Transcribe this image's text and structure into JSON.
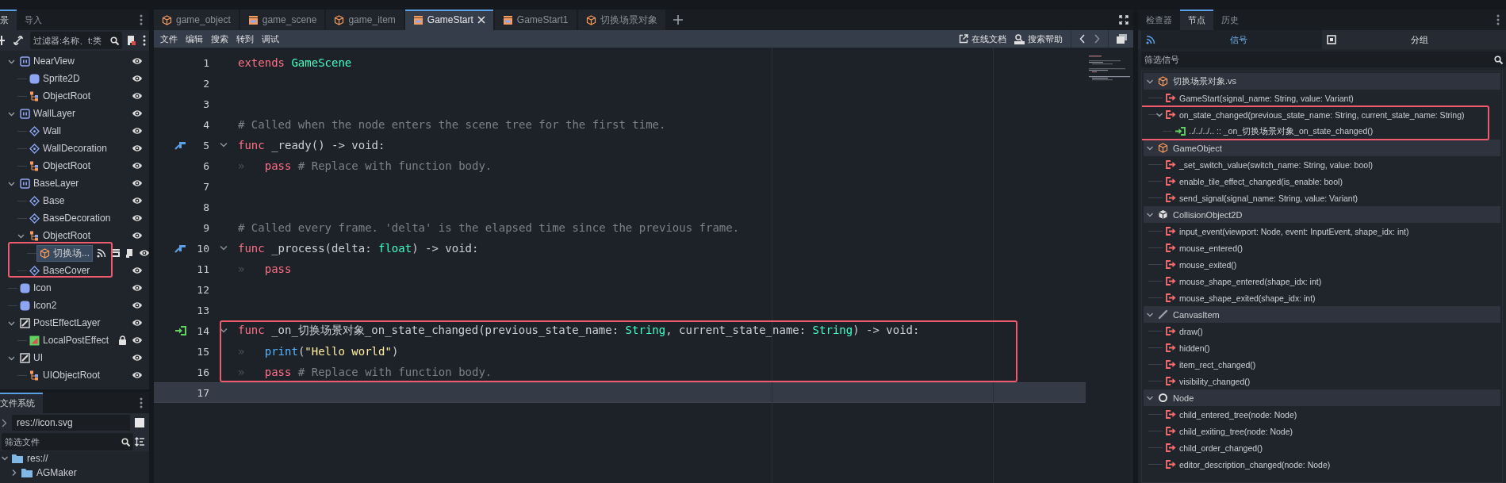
{
  "left_tabs": [
    {
      "label": "景",
      "selected": true
    },
    {
      "label": "导入",
      "selected": false
    }
  ],
  "scene_filter": {
    "placeholder": "过滤器:名称、t:类"
  },
  "scene_tree": [
    {
      "name": "NearView",
      "kind": "layer",
      "expanded": true,
      "children": [
        {
          "name": "Sprite2D",
          "kind": "sprite"
        },
        {
          "name": "ObjectRoot",
          "kind": "root"
        }
      ]
    },
    {
      "name": "WallLayer",
      "kind": "layer",
      "expanded": true,
      "children": [
        {
          "name": "Wall",
          "kind": "marker"
        },
        {
          "name": "WallDecoration",
          "kind": "marker"
        },
        {
          "name": "ObjectRoot",
          "kind": "root"
        }
      ]
    },
    {
      "name": "BaseLayer",
      "kind": "layer",
      "expanded": true,
      "children": [
        {
          "name": "Base",
          "kind": "marker"
        },
        {
          "name": "BaseDecoration",
          "kind": "marker"
        },
        {
          "name": "ObjectRoot",
          "kind": "root",
          "expanded": true,
          "children": [
            {
              "name": "切换场...",
              "kind": "object",
              "selected": true,
              "annotated": true,
              "signals": true,
              "instance": true,
              "script": true
            }
          ]
        },
        {
          "name": "BaseCover",
          "kind": "marker"
        }
      ]
    },
    {
      "name": "Icon",
      "kind": "sprite"
    },
    {
      "name": "Icon2",
      "kind": "sprite"
    },
    {
      "name": "PostEffectLayer",
      "kind": "canvas",
      "expanded": true,
      "children": [
        {
          "name": "LocalPostEffect",
          "kind": "post",
          "locked": true
        }
      ]
    },
    {
      "name": "UI",
      "kind": "canvas",
      "expanded": true,
      "children": [
        {
          "name": "UIObjectRoot",
          "kind": "root"
        }
      ]
    }
  ],
  "filesystem": {
    "tab": "文件系统",
    "path": "res://icon.svg",
    "filter": {
      "placeholder": "筛选文件"
    },
    "items": [
      {
        "name": "res://",
        "expanded": true
      },
      {
        "name": "AGMaker",
        "expanded": false
      }
    ]
  },
  "editor_tabs": [
    {
      "label": "game_object",
      "kind": "object",
      "selected": false
    },
    {
      "label": "game_scene",
      "kind": "scene",
      "selected": false
    },
    {
      "label": "game_item",
      "kind": "object",
      "selected": false
    },
    {
      "label": "GameStart",
      "kind": "scene",
      "selected": true
    },
    {
      "label": "GameStart1",
      "kind": "scene",
      "selected": false
    },
    {
      "label": "切换场景对象",
      "kind": "object",
      "selected": false
    }
  ],
  "editor_menu": [
    "文件",
    "编辑",
    "搜索",
    "转到",
    "调试"
  ],
  "help_buttons": [
    {
      "label": "在线文档",
      "kind": "docs"
    },
    {
      "label": "搜索帮助",
      "kind": "help"
    }
  ],
  "code": {
    "lines": [
      {
        "number": "1",
        "current": false,
        "segments": [
          {
            "text": "extends",
            "kind": "keyword"
          },
          {
            "text": " GameScene",
            "kind": "type"
          }
        ]
      },
      {
        "number": "2",
        "current": false
      },
      {
        "number": "3",
        "current": false
      },
      {
        "number": "4",
        "current": false,
        "segments": [
          {
            "text": "# Called when the node enters the scene tree for the first time.",
            "kind": "comment"
          }
        ]
      },
      {
        "number": "5",
        "current": false,
        "connected": true,
        "foldable": true,
        "segments": [
          {
            "text": "func",
            "kind": "keyword"
          },
          {
            "text": " _ready() -> void:",
            "kind": "plain"
          }
        ]
      },
      {
        "number": "6",
        "current": false,
        "segments": [
          {
            "text": "»",
            "kind": "tab"
          },
          {
            "text": "pass",
            "kind": "keyword"
          },
          {
            "text": " # Replace with function body.",
            "kind": "comment"
          }
        ]
      },
      {
        "number": "7",
        "current": false
      },
      {
        "number": "8",
        "current": false
      },
      {
        "number": "9",
        "current": false,
        "segments": [
          {
            "text": "# Called every frame. 'delta' is the elapsed time since the previous frame.",
            "kind": "comment"
          }
        ]
      },
      {
        "number": "10",
        "current": false,
        "connected": true,
        "foldable": true,
        "segments": [
          {
            "text": "func",
            "kind": "keyword"
          },
          {
            "text": " _process(delta: ",
            "kind": "plain"
          },
          {
            "text": "float",
            "kind": "type"
          },
          {
            "text": ") -> void:",
            "kind": "plain"
          }
        ]
      },
      {
        "number": "11",
        "current": false,
        "segments": [
          {
            "text": "»",
            "kind": "tab"
          },
          {
            "text": "pass",
            "kind": "keyword"
          }
        ]
      },
      {
        "number": "12",
        "current": false
      },
      {
        "number": "13",
        "current": false
      },
      {
        "number": "14",
        "current": false,
        "annotated": true,
        "receiver": true,
        "foldable": true,
        "segments": [
          {
            "text": "func",
            "kind": "keyword"
          },
          {
            "text": " _on_切换场景对象_on_state_changed(previous_state_name: ",
            "kind": "plain"
          },
          {
            "text": "String",
            "kind": "type"
          },
          {
            "text": ", current_state_name: ",
            "kind": "plain"
          },
          {
            "text": "String",
            "kind": "type"
          },
          {
            "text": ") -> void:",
            "kind": "plain"
          }
        ]
      },
      {
        "number": "15",
        "current": false,
        "annotated": true,
        "segments": [
          {
            "text": "»",
            "kind": "tab"
          },
          {
            "text": "print",
            "kind": "call"
          },
          {
            "text": "(",
            "kind": "plain"
          },
          {
            "text": "\"Hello world\"",
            "kind": "string"
          },
          {
            "text": ")",
            "kind": "plain"
          }
        ]
      },
      {
        "number": "16",
        "current": false,
        "annotated": true,
        "segments": [
          {
            "text": "»",
            "kind": "tab"
          },
          {
            "text": "pass",
            "kind": "keyword"
          },
          {
            "text": " # Replace with function body.",
            "kind": "comment"
          }
        ]
      },
      {
        "number": "17",
        "current": true
      }
    ]
  },
  "right_tabs": [
    {
      "label": "检查器",
      "selected": false
    },
    {
      "label": "节点",
      "selected": true
    },
    {
      "label": "历史",
      "selected": false
    }
  ],
  "node_tabs": [
    {
      "label": "信号",
      "kind": "signal",
      "selected": true
    },
    {
      "label": "分组",
      "kind": "group",
      "selected": false
    }
  ],
  "signal_filter": {
    "placeholder": "筛选信号"
  },
  "signal_groups": [
    {
      "name": "切换场景对象.vs",
      "kind": "object",
      "expanded": true,
      "signals": [
        {
          "text": "GameStart(signal_name: String, value: Variant)"
        },
        {
          "text": "on_state_changed(previous_state_name: String, current_state_name: String)",
          "expanded": true,
          "annotated": true,
          "children": [
            {
              "text": "../../../.. :: _on_切换场景对象_on_state_changed()"
            }
          ]
        }
      ]
    },
    {
      "name": "GameObject",
      "kind": "object",
      "expanded": true,
      "signals": [
        {
          "text": "_set_switch_value(switch_name: String, value: bool)"
        },
        {
          "text": "enable_tile_effect_changed(is_enable: bool)"
        },
        {
          "text": "send_signal(signal_name: String, value: Variant)"
        }
      ]
    },
    {
      "name": "CollisionObject2D",
      "kind": "collision",
      "expanded": true,
      "signals": [
        {
          "text": "input_event(viewport: Node, event: InputEvent, shape_idx: int)"
        },
        {
          "text": "mouse_entered()"
        },
        {
          "text": "mouse_exited()"
        },
        {
          "text": "mouse_shape_entered(shape_idx: int)"
        },
        {
          "text": "mouse_shape_exited(shape_idx: int)"
        }
      ]
    },
    {
      "name": "CanvasItem",
      "kind": "canvas",
      "expanded": true,
      "signals": [
        {
          "text": "draw()"
        },
        {
          "text": "hidden()"
        },
        {
          "text": "item_rect_changed()"
        },
        {
          "text": "visibility_changed()"
        }
      ]
    },
    {
      "name": "Node",
      "kind": "node",
      "expanded": true,
      "signals": [
        {
          "text": "child_entered_tree(node: Node)"
        },
        {
          "text": "child_exiting_tree(node: Node)"
        },
        {
          "text": "child_order_changed()"
        },
        {
          "text": "editor_description_changed(node: Node)"
        }
      ]
    }
  ]
}
